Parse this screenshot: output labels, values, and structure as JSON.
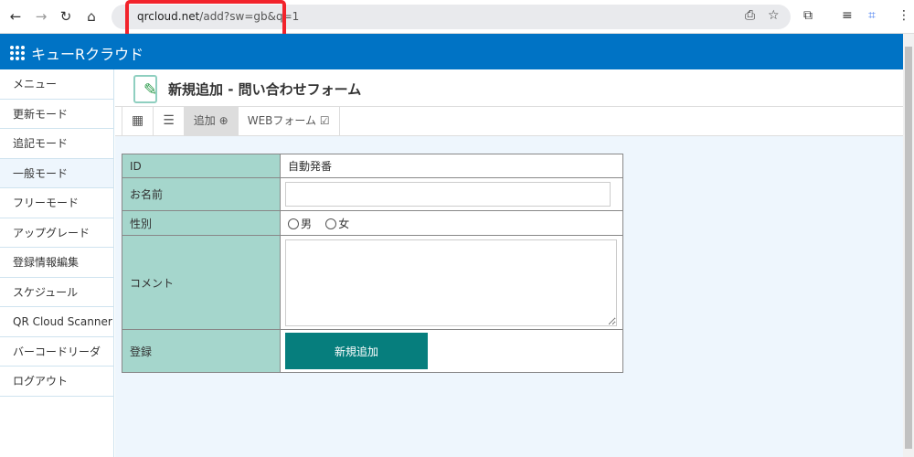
{
  "browser": {
    "url_host": "qrcloud.net",
    "url_path": "/add?sw=gb&q=1"
  },
  "header": {
    "brand": "キューRクラウド"
  },
  "sidebar": {
    "items": [
      {
        "label": "メニュー"
      },
      {
        "label": "更新モード"
      },
      {
        "label": "追記モード"
      },
      {
        "label": "一般モード",
        "active": true
      },
      {
        "label": "フリーモード"
      },
      {
        "label": "アップグレード"
      },
      {
        "label": "登録情報編集"
      },
      {
        "label": "スケジュール"
      },
      {
        "label": "QR Cloud Scanner"
      },
      {
        "label": "バーコードリーダ"
      },
      {
        "label": "ログアウト"
      }
    ]
  },
  "page": {
    "title": "新規追加 - 問い合わせフォーム"
  },
  "tabs": {
    "add": "追加",
    "webform": "WEBフォーム"
  },
  "form": {
    "id_label": "ID",
    "id_value": "自動発番",
    "name_label": "お名前",
    "name_value": "",
    "gender_label": "性別",
    "male": "男",
    "female": "女",
    "comment_label": "コメント",
    "comment_value": "",
    "register_label": "登録",
    "submit": "新規追加"
  },
  "colors": {
    "header": "#0073c5",
    "label_cell": "#a5d6cc",
    "button": "#067e7d",
    "highlight": "#f2232b"
  }
}
